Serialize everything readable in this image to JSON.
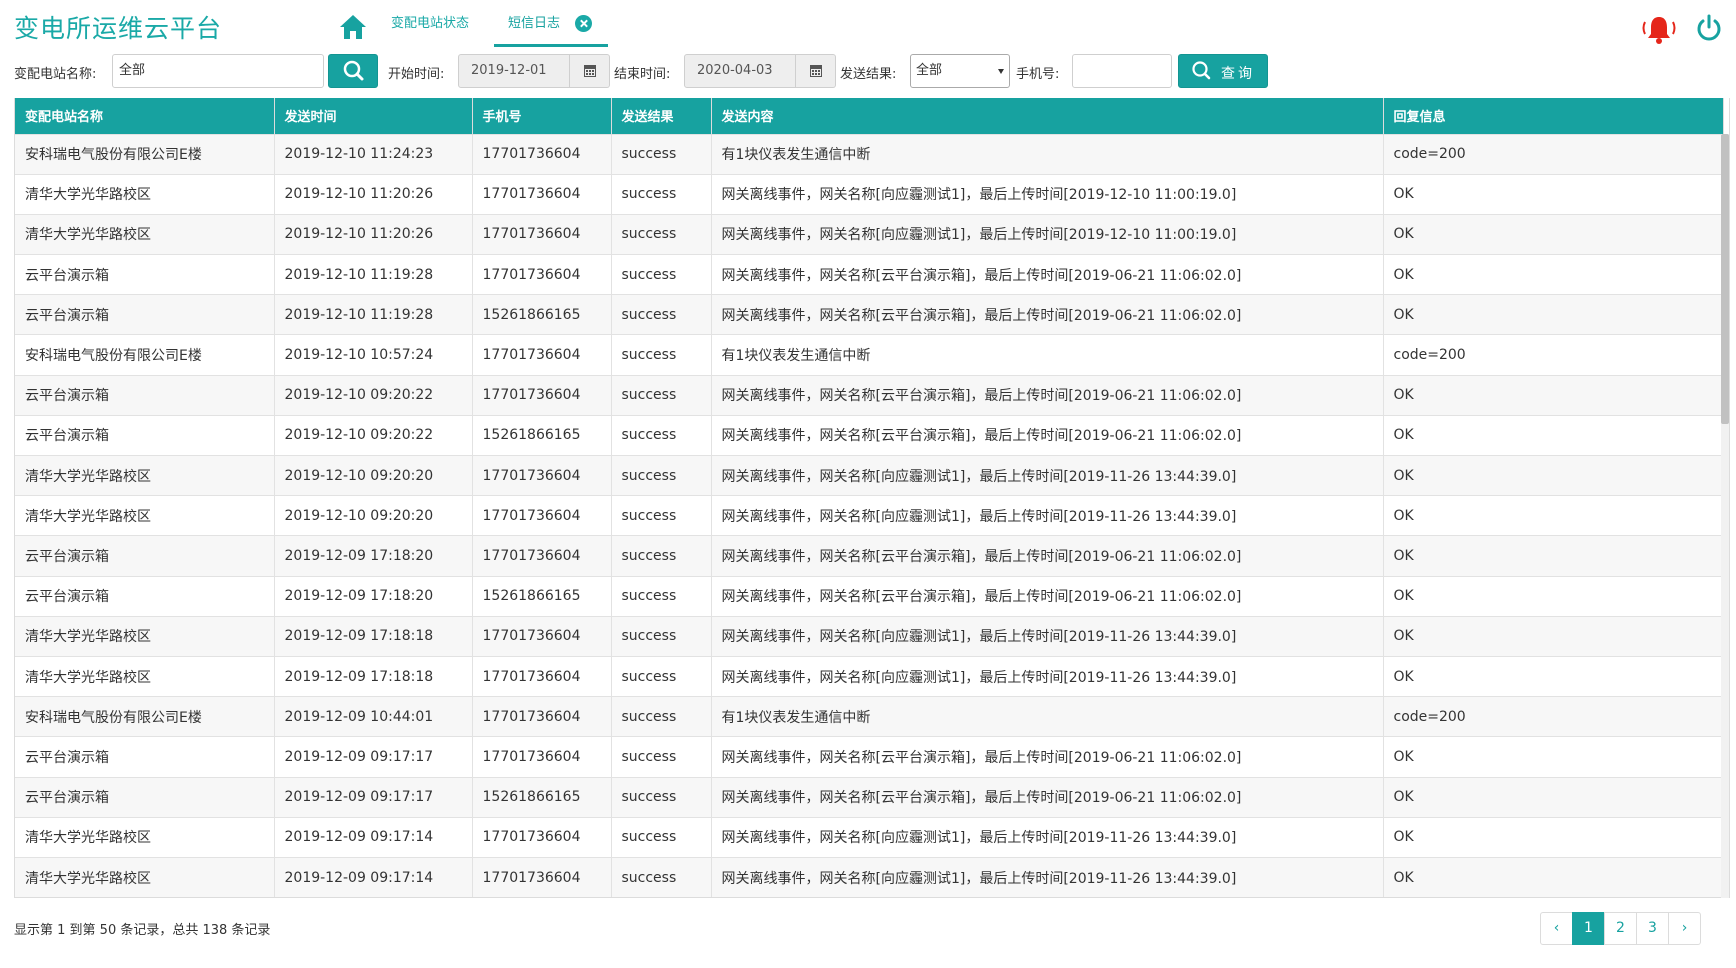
{
  "app": {
    "title": "变电所运维云平台"
  },
  "tabs": [
    {
      "label": "变配电站状态"
    },
    {
      "label": "短信日志"
    }
  ],
  "icons": {
    "home": "home-icon",
    "close": "close-circle-icon",
    "bell": "bell-icon",
    "power": "power-icon",
    "search": "search-icon",
    "calendar": "calendar-icon"
  },
  "colors": {
    "accent": "#17a2a0",
    "alert": "#e5261a",
    "header_text": "#ffffff"
  },
  "filters": {
    "station_label": "变配电站名称:",
    "station_value": "全部",
    "start_label": "开始时间:",
    "start_value": "2019-12-01",
    "end_label": "结束时间:",
    "end_value": "2020-04-03",
    "result_label": "发送结果:",
    "result_value": "全部",
    "phone_label": "手机号:",
    "phone_value": "",
    "query_label": "查询"
  },
  "table": {
    "columns": [
      "变配电站名称",
      "发送时间",
      "手机号",
      "发送结果",
      "发送内容",
      "回复信息"
    ],
    "rows": [
      [
        "安科瑞电气股份有限公司E楼",
        "2019-12-10 11:24:23",
        "17701736604",
        "success",
        "有1块仪表发生通信中断",
        "code=200"
      ],
      [
        "清华大学光华路校区",
        "2019-12-10 11:20:26",
        "17701736604",
        "success",
        "网关离线事件，网关名称[向应霾测试1]，最后上传时间[2019-12-10 11:00:19.0]",
        "OK"
      ],
      [
        "清华大学光华路校区",
        "2019-12-10 11:20:26",
        "17701736604",
        "success",
        "网关离线事件，网关名称[向应霾测试1]，最后上传时间[2019-12-10 11:00:19.0]",
        "OK"
      ],
      [
        "云平台演示箱",
        "2019-12-10 11:19:28",
        "17701736604",
        "success",
        "网关离线事件，网关名称[云平台演示箱]，最后上传时间[2019-06-21 11:06:02.0]",
        "OK"
      ],
      [
        "云平台演示箱",
        "2019-12-10 11:19:28",
        "15261866165",
        "success",
        "网关离线事件，网关名称[云平台演示箱]，最后上传时间[2019-06-21 11:06:02.0]",
        "OK"
      ],
      [
        "安科瑞电气股份有限公司E楼",
        "2019-12-10 10:57:24",
        "17701736604",
        "success",
        "有1块仪表发生通信中断",
        "code=200"
      ],
      [
        "云平台演示箱",
        "2019-12-10 09:20:22",
        "17701736604",
        "success",
        "网关离线事件，网关名称[云平台演示箱]，最后上传时间[2019-06-21 11:06:02.0]",
        "OK"
      ],
      [
        "云平台演示箱",
        "2019-12-10 09:20:22",
        "15261866165",
        "success",
        "网关离线事件，网关名称[云平台演示箱]，最后上传时间[2019-06-21 11:06:02.0]",
        "OK"
      ],
      [
        "清华大学光华路校区",
        "2019-12-10 09:20:20",
        "17701736604",
        "success",
        "网关离线事件，网关名称[向应霾测试1]，最后上传时间[2019-11-26 13:44:39.0]",
        "OK"
      ],
      [
        "清华大学光华路校区",
        "2019-12-10 09:20:20",
        "17701736604",
        "success",
        "网关离线事件，网关名称[向应霾测试1]，最后上传时间[2019-11-26 13:44:39.0]",
        "OK"
      ],
      [
        "云平台演示箱",
        "2019-12-09 17:18:20",
        "17701736604",
        "success",
        "网关离线事件，网关名称[云平台演示箱]，最后上传时间[2019-06-21 11:06:02.0]",
        "OK"
      ],
      [
        "云平台演示箱",
        "2019-12-09 17:18:20",
        "15261866165",
        "success",
        "网关离线事件，网关名称[云平台演示箱]，最后上传时间[2019-06-21 11:06:02.0]",
        "OK"
      ],
      [
        "清华大学光华路校区",
        "2019-12-09 17:18:18",
        "17701736604",
        "success",
        "网关离线事件，网关名称[向应霾测试1]，最后上传时间[2019-11-26 13:44:39.0]",
        "OK"
      ],
      [
        "清华大学光华路校区",
        "2019-12-09 17:18:18",
        "17701736604",
        "success",
        "网关离线事件，网关名称[向应霾测试1]，最后上传时间[2019-11-26 13:44:39.0]",
        "OK"
      ],
      [
        "安科瑞电气股份有限公司E楼",
        "2019-12-09 10:44:01",
        "17701736604",
        "success",
        "有1块仪表发生通信中断",
        "code=200"
      ],
      [
        "云平台演示箱",
        "2019-12-09 09:17:17",
        "17701736604",
        "success",
        "网关离线事件，网关名称[云平台演示箱]，最后上传时间[2019-06-21 11:06:02.0]",
        "OK"
      ],
      [
        "云平台演示箱",
        "2019-12-09 09:17:17",
        "15261866165",
        "success",
        "网关离线事件，网关名称[云平台演示箱]，最后上传时间[2019-06-21 11:06:02.0]",
        "OK"
      ],
      [
        "清华大学光华路校区",
        "2019-12-09 09:17:14",
        "17701736604",
        "success",
        "网关离线事件，网关名称[向应霾测试1]，最后上传时间[2019-11-26 13:44:39.0]",
        "OK"
      ],
      [
        "清华大学光华路校区",
        "2019-12-09 09:17:14",
        "17701736604",
        "success",
        "网关离线事件，网关名称[向应霾测试1]，最后上传时间[2019-11-26 13:44:39.0]",
        "OK"
      ]
    ]
  },
  "footer": {
    "summary": "显示第 1 到第 50 条记录，总共 138 条记录",
    "pages": [
      "1",
      "2",
      "3"
    ],
    "current_page": "1",
    "prev": "‹",
    "next": "›"
  }
}
